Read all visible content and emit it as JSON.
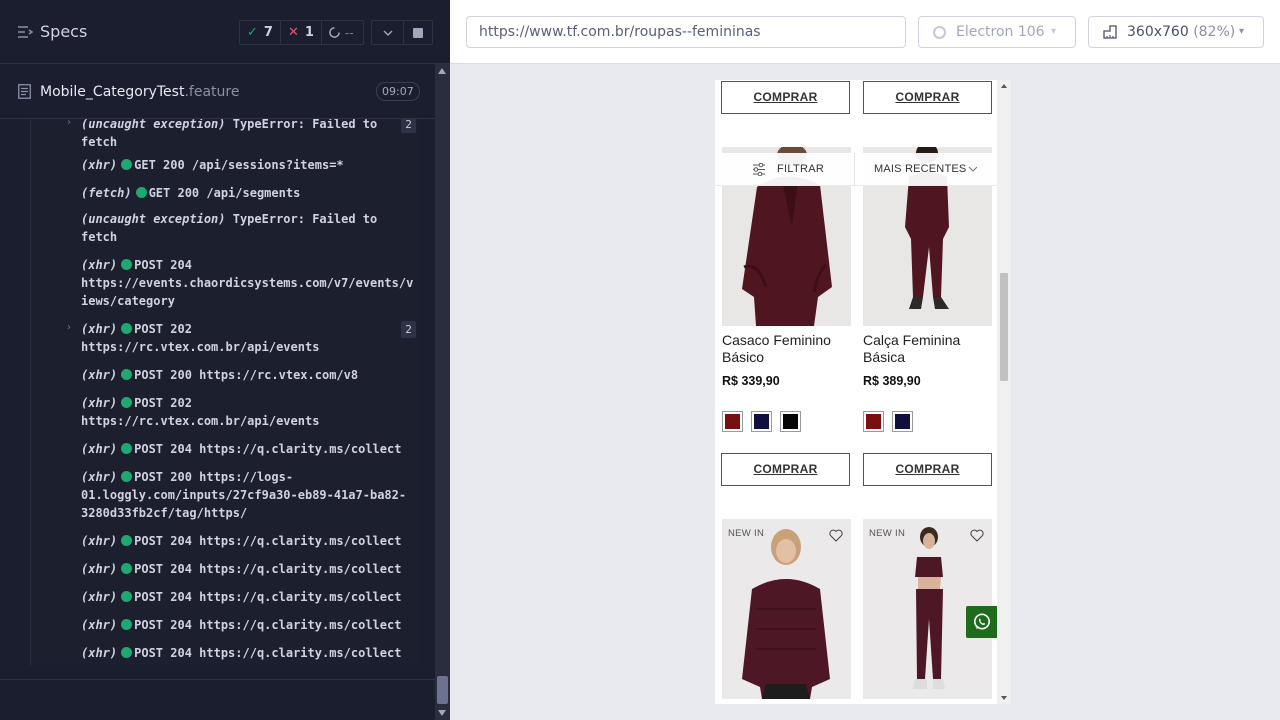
{
  "reporter": {
    "title": "Specs",
    "stats": {
      "passed": "7",
      "failed": "1",
      "pending": "--"
    },
    "spec_file": {
      "name": "Mobile_CategoryTest",
      "ext": ".feature",
      "duration": "09:07"
    },
    "commands": [
      {
        "kind": "(uncaught exception)",
        "dot": false,
        "text": "TypeError: Failed to",
        "text2": "fetch",
        "badge": "2",
        "caret": true
      },
      {
        "kind": "(xhr)",
        "dot": true,
        "text": "GET 200 /api/sessions?items=*"
      },
      {
        "kind": "(fetch)",
        "dot": true,
        "text": "GET 200 /api/segments"
      },
      {
        "kind": "(uncaught exception)",
        "dot": false,
        "text": "TypeError: Failed to",
        "text2": "fetch"
      },
      {
        "kind": "(xhr)",
        "dot": true,
        "text": "POST 204",
        "text2": "https://events.chaordicsystems.com/v7/events/v",
        "text3": "iews/category"
      },
      {
        "kind": "(xhr)",
        "dot": true,
        "text": "POST 202",
        "text2": "https://rc.vtex.com.br/api/events",
        "badge": "2",
        "caret": true
      },
      {
        "kind": "(xhr)",
        "dot": true,
        "text": "POST 200 https://rc.vtex.com/v8"
      },
      {
        "kind": "(xhr)",
        "dot": true,
        "text": "POST 202",
        "text2": "https://rc.vtex.com.br/api/events"
      },
      {
        "kind": "(xhr)",
        "dot": true,
        "text": "POST 204 https://q.clarity.ms/collect"
      },
      {
        "kind": "(xhr)",
        "dot": true,
        "text": "POST 200 https://logs-",
        "text2": "01.loggly.com/inputs/27cf9a30-eb89-41a7-ba82-",
        "text3": "3280d33fb2cf/tag/https/"
      },
      {
        "kind": "(xhr)",
        "dot": true,
        "text": "POST 204 https://q.clarity.ms/collect"
      },
      {
        "kind": "(xhr)",
        "dot": true,
        "text": "POST 204 https://q.clarity.ms/collect"
      },
      {
        "kind": "(xhr)",
        "dot": true,
        "text": "POST 204 https://q.clarity.ms/collect"
      },
      {
        "kind": "(xhr)",
        "dot": true,
        "text": "POST 204 https://q.clarity.ms/collect"
      },
      {
        "kind": "(xhr)",
        "dot": true,
        "text": "POST 204 https://q.clarity.ms/collect"
      }
    ]
  },
  "aut": {
    "url": "https://www.tf.com.br/roupas--femininas",
    "browser": "Electron 106",
    "viewport": "360x760",
    "zoom": "(82%)"
  },
  "page": {
    "buy_label": "COMPRAR",
    "filter_label": "FILTRAR",
    "sort_label": "MAIS RECENTES",
    "new_in_label": "NEW IN",
    "products": [
      {
        "name": "Casaco Feminino Básico",
        "price": "R$ 339,90",
        "swatches": [
          "#7a0f0f",
          "#0f1040",
          "#050505"
        ]
      },
      {
        "name": "Calça Feminina Básica",
        "price": "R$ 389,90",
        "swatches": [
          "#7a0f0f",
          "#0f1040"
        ]
      }
    ]
  },
  "colors": {
    "pass": "#1fa971",
    "fail": "#e45770",
    "whatsapp": "#1e6b1b",
    "burgundy": "#5a1a25"
  }
}
